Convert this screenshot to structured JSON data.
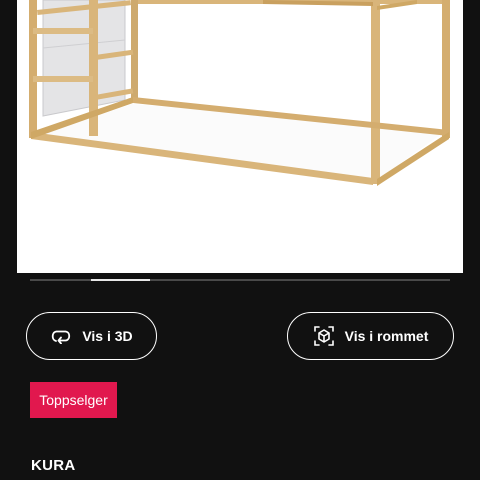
{
  "gallery": {
    "image_alt": "KURA bed frame",
    "slide_count": 7,
    "active_slide": 2
  },
  "actions": {
    "view_3d_label": "Vis i 3D",
    "view_3d_icon": "rotate-3d-icon",
    "view_room_label": "Vis i rommet",
    "view_room_icon": "ar-cube-icon"
  },
  "badge": {
    "label": "Toppselger",
    "color": "#e1184e"
  },
  "product": {
    "name": "KURA"
  },
  "colors": {
    "background": "#111111",
    "accent": "#e1184e",
    "wood": "#d9b57a"
  }
}
